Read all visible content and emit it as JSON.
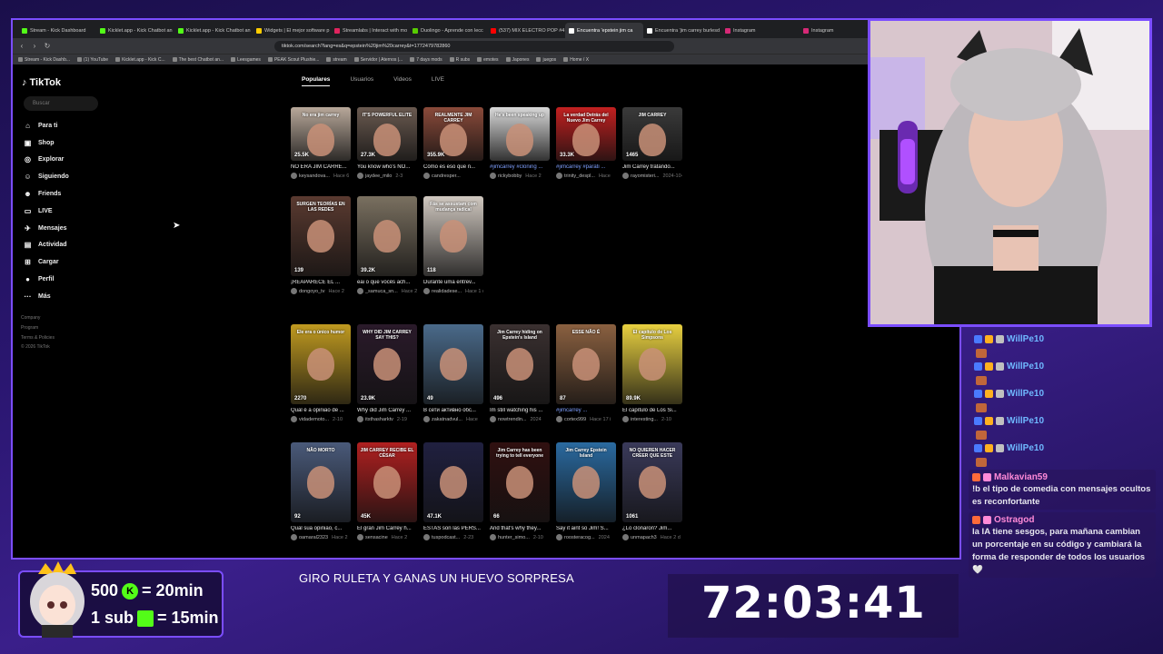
{
  "browser": {
    "tabs": [
      {
        "label": "Stream - Kick Dashboard",
        "color": "#53fc18"
      },
      {
        "label": "Kicklet.app - Kick Chatbot an",
        "color": "#53fc18"
      },
      {
        "label": "Kicklet.app - Kick Chatbot an",
        "color": "#53fc18"
      },
      {
        "label": "Widgets | El mejor software p",
        "color": "#ffcc00"
      },
      {
        "label": "Streamlabs | Interact with mo",
        "color": "#e0245e"
      },
      {
        "label": "Duolingo - Aprende con lecc",
        "color": "#58cc02"
      },
      {
        "label": "(537) MIX ELECTRO POP #4 (2",
        "color": "#ff0000"
      },
      {
        "label": "Encuentra 'epstein jim ca",
        "color": "#ffffff",
        "active": true
      },
      {
        "label": "Encuentra 'jim carrey burlesd",
        "color": "#ffffff"
      },
      {
        "label": "Instagram",
        "color": "#d62976"
      },
      {
        "label": "Instagram",
        "color": "#d62976"
      }
    ],
    "url": "tiktok.com/search?lang=es&q=epstein%20jim%20carrey&t=1772479782860",
    "bookmarks": [
      "Stream - Kick Dashb...",
      "(1) YouTube",
      "Kicklet.app - Kick C...",
      "The best Chatbot an...",
      "Leesgames",
      "PEAK Scout Plushie...",
      "stream",
      "Servidor | Aternos |...",
      "7 days mods",
      "R subs",
      "emotes",
      "Japones",
      "juegos",
      "Home / X"
    ]
  },
  "tiktok": {
    "logo": "TikTok",
    "search_placeholder": "Buscar",
    "nav": [
      {
        "label": "Para ti",
        "icon": "home-icon",
        "glyph": "⌂"
      },
      {
        "label": "Shop",
        "icon": "shop-icon",
        "glyph": "▣"
      },
      {
        "label": "Explorar",
        "icon": "compass-icon",
        "glyph": "◎"
      },
      {
        "label": "Siguiendo",
        "icon": "following-icon",
        "glyph": "☺"
      },
      {
        "label": "Friends",
        "icon": "friends-icon",
        "glyph": "☻"
      },
      {
        "label": "LIVE",
        "icon": "live-icon",
        "glyph": "▭"
      },
      {
        "label": "Mensajes",
        "icon": "messages-icon",
        "glyph": "✈"
      },
      {
        "label": "Actividad",
        "icon": "activity-icon",
        "glyph": "▤"
      },
      {
        "label": "Cargar",
        "icon": "upload-icon",
        "glyph": "⊞"
      },
      {
        "label": "Perfil",
        "icon": "profile-icon",
        "glyph": "●"
      },
      {
        "label": "Más",
        "icon": "more-icon",
        "glyph": "···"
      }
    ],
    "footer": [
      "Company",
      "Program",
      "Terms & Policies",
      "© 2026 TikTok"
    ],
    "search_tabs": [
      "Populares",
      "Usuarios",
      "Videos",
      "LIVE"
    ],
    "rows": [
      [
        {
          "views": "25.5K",
          "title": "NO ERA JIM CARRE...",
          "user": "keysandova...",
          "time": "Hace 6",
          "bg": "#b8a89a",
          "cap": "No era jim carrey"
        },
        {
          "views": "27.3K",
          "title": "You know who's NO...",
          "user": "jaydee_milo",
          "time": "2-3",
          "bg": "#6a5a50",
          "cap": "IT'S POWERFUL ELITE"
        },
        {
          "views": "355.9K",
          "title": "Cómo es eso que n...",
          "user": "candresper...",
          "time": "",
          "bg": "#8a4a3a",
          "cap": "REALMENTE JIM CARREY"
        },
        {
          "views": "",
          "title": "#jimcarrey #cloning ...",
          "user": "rickybobby",
          "time": "Hace 2",
          "bg": "#d8d8d8",
          "cap": "He's been speaking up",
          "tag": true
        },
        {
          "views": "33.3K",
          "title": "#jimcarrey #parati ...",
          "user": "trinity_despl...",
          "time": "Hace",
          "bg": "#c22020",
          "cap": "La verdad Detrás del Nuevo Jim Carrey",
          "tag": true
        },
        {
          "views": "1465",
          "title": "Jim Carrey tratando...",
          "user": "rayomisteri...",
          "time": "2024-10-25",
          "bg": "#3a3a3a",
          "cap": "JIM CARREY"
        }
      ],
      [
        {
          "views": "139",
          "title": "¡REAPARECE EL ...",
          "user": "dongoyo_tv",
          "time": "Hace 2",
          "bg": "#5a3a30",
          "cap": "SURGEN TEORÍAS EN LAS REDES"
        },
        {
          "views": "39.2K",
          "title": "eai o que vocês ach...",
          "user": "_samuca_sn...",
          "time": "Hace 2",
          "bg": "#7a7060",
          "cap": ""
        },
        {
          "views": "118",
          "title": "Durante uma entrev...",
          "user": "realidadese...",
          "time": "Hace 1 d",
          "bg": "#d0c8c0",
          "cap": "Fãs se assustam com mudança radical"
        }
      ],
      [
        {
          "views": "2270",
          "title": "Qual é a opinião de ...",
          "user": "vidademoto...",
          "time": "2-10",
          "bg": "#c09a20",
          "cap": "Ele era o único humor"
        },
        {
          "views": "23.9K",
          "title": "Why did Jim Carrey ...",
          "user": "itsthasharktv",
          "time": "2-19",
          "bg": "#2a1a2a",
          "cap": "WHY DID JIM CARREY SAY THIS?"
        },
        {
          "views": "49",
          "title": "В сети активно обс...",
          "user": "zakatnadvul...",
          "time": "Hace",
          "bg": "#4a6a8a",
          "cap": ""
        },
        {
          "views": "496",
          "title": "Im still watching his ...",
          "user": "nowtrendin...",
          "time": "2024",
          "bg": "#3a3030",
          "cap": "Jim Carrey hiding on Epstein's Island"
        },
        {
          "views": "87",
          "title": "#jimcarrey ...",
          "user": "cortex999",
          "time": "Hace 17 i",
          "bg": "#8a6040",
          "cap": "ESSE NÃO É",
          "tag": true
        },
        {
          "views": "89.9K",
          "title": "El capítulo de Los Si...",
          "user": "interesting...",
          "time": "2-10",
          "bg": "#e8d040",
          "cap": "El capítulo de Los Simpsons"
        }
      ],
      [
        {
          "views": "92",
          "title": "Qual sua opinião, c...",
          "user": "oamaral2323",
          "time": "Hace 2",
          "bg": "#4a5a7a",
          "cap": "NÃO MORTO"
        },
        {
          "views": "45K",
          "title": "El gran Jim Carrey h...",
          "user": "sensacine",
          "time": "Hace 2",
          "bg": "#b02020",
          "cap": "JIM CARREY RECIBE EL CÉSAR"
        },
        {
          "views": "47.1K",
          "title": "ESTAS son las PERS...",
          "user": "tuspodcast...",
          "time": "2-23",
          "bg": "#202040",
          "cap": ""
        },
        {
          "views": "66",
          "title": "And that's why they...",
          "user": "hunter_simo...",
          "time": "2-10",
          "bg": "#301010",
          "cap": "Jim Carrey has been trying to tell everyone"
        },
        {
          "views": "",
          "title": "Say it aint so Jim! S...",
          "user": "roosteracog...",
          "time": "2024",
          "bg": "#2a6aa0",
          "cap": "Jim Carrey Epstein Island"
        },
        {
          "views": "1061",
          "title": "¿Lo clonaron? Jim...",
          "user": "unmapach3",
          "time": "Hace 2 d",
          "bg": "#3a3a5a",
          "cap": "NO QUIEREN HACER CREER QUE ESTE"
        }
      ]
    ]
  },
  "chat": {
    "repeat_user": "WillPe10",
    "repeat_color": "#6fb8ff",
    "messages": [
      {
        "user": "Malkavian59",
        "color": "#ff8ad8",
        "text": "!b el tipo de comedia con mensajes ocultos es reconfortante"
      },
      {
        "user": "Ostragod",
        "color": "#ff8ad8",
        "text": "la IA tiene sesgos, para mañana cambian un porcentaje en su código y cambiará la forma de responder de todos los usuarios 🤍"
      }
    ]
  },
  "overlay": {
    "sub_line1_amount": "500",
    "sub_line1_rest": "= 20min",
    "sub_line2_amount": "1 sub",
    "sub_line2_rest": "= 15min",
    "ruleta": "GIRO RULETA Y GANAS UN HUEVO SORPRESA",
    "timer": "72:03:41",
    "accent": "#7b4dff",
    "kick_green": "#53fc18"
  }
}
